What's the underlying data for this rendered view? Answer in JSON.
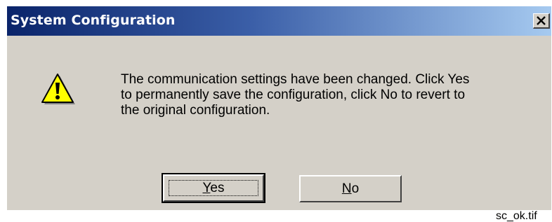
{
  "dialog": {
    "title": "System Configuration",
    "close_glyph": "×",
    "icon": "warning-icon",
    "message_lines": [
      "The communication settings have been changed. Click Yes",
      "to permanently save the configuration, click No to revert to",
      "the original configuration."
    ],
    "buttons": {
      "yes": {
        "accel": "Y",
        "rest": "es"
      },
      "no": {
        "accel": "N",
        "rest": "o"
      }
    }
  },
  "caption": "sc_ok.tif",
  "colors": {
    "dialog_face": "#d4d0c8",
    "title_start": "#0a246a",
    "title_end": "#a6caf0",
    "warning_fill": "#ffff00"
  }
}
